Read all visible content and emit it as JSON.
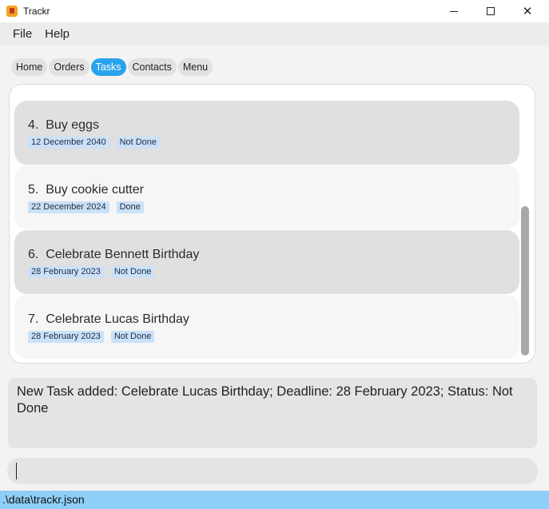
{
  "window": {
    "title": "Trackr",
    "icon": "trackr-app-icon"
  },
  "menu": [
    "File",
    "Help"
  ],
  "tabs": [
    {
      "label": "Home",
      "active": false
    },
    {
      "label": "Orders",
      "active": false
    },
    {
      "label": "Tasks",
      "active": true
    },
    {
      "label": "Contacts",
      "active": false
    },
    {
      "label": "Menu",
      "active": false
    }
  ],
  "tasks": [
    {
      "index": "4.",
      "name": "Buy eggs",
      "deadline": "12 December 2040",
      "status": "Not Done"
    },
    {
      "index": "5.",
      "name": "Buy cookie cutter",
      "deadline": "22 December 2024",
      "status": "Done"
    },
    {
      "index": "6.",
      "name": "Celebrate Bennett Birthday",
      "deadline": "28 February 2023",
      "status": "Not Done"
    },
    {
      "index": "7.",
      "name": "Celebrate Lucas Birthday",
      "deadline": "28 February 2023",
      "status": "Not Done"
    }
  ],
  "result": "New Task added: Celebrate Lucas Birthday; Deadline: 28 February 2023; Status: Not Done",
  "command_input": {
    "value": ""
  },
  "status_bar": ".\\data\\trackr.json",
  "colors": {
    "active_tab": "#2aa3ec",
    "tag_bg": "#cbe1f7",
    "status_bar": "#8fcff7"
  }
}
